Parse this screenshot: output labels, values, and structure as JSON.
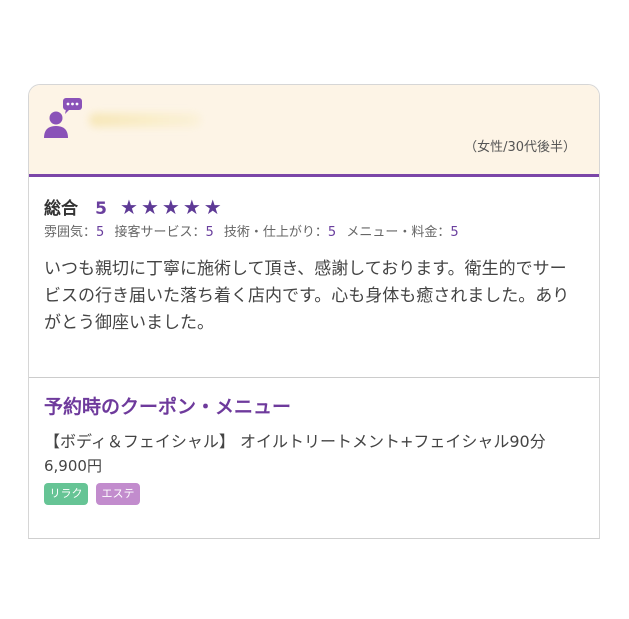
{
  "colors": {
    "accent": "#7b46a8",
    "header_bg": "#fdf4e6",
    "rating_value": "#6a3f9e",
    "stars": "#5e3a96",
    "text": "#444444",
    "muted": "#666666",
    "border": "#d6d6d6"
  },
  "reviewer": {
    "avatar_icon": "user-comment-icon",
    "meta": "（女性/30代後半）"
  },
  "rating": {
    "overall_label": "総合",
    "overall_value": "5",
    "stars": "★★★★★",
    "sub": [
      {
        "label": "雰囲気：",
        "value": "5"
      },
      {
        "label": "接客サービス：",
        "value": "5"
      },
      {
        "label": "技術・仕上がり：",
        "value": "5"
      },
      {
        "label": "メニュー・料金：",
        "value": "5"
      }
    ]
  },
  "review": {
    "text": "いつも親切に丁寧に施術して頂き、感謝しております。衛生的でサービスの行き届いた落ち着く店内です。心も身体も癒されました。ありがとう御座いました。"
  },
  "coupon": {
    "heading": "予約時のクーポン・メニュー",
    "title": "【ボディ＆フェイシャル】 オイルトリートメント+フェイシャル90分",
    "price": "6,900円",
    "tags": [
      {
        "label": "リラク",
        "color": "#66c495"
      },
      {
        "label": "エステ",
        "color": "#c28ccd"
      }
    ]
  }
}
